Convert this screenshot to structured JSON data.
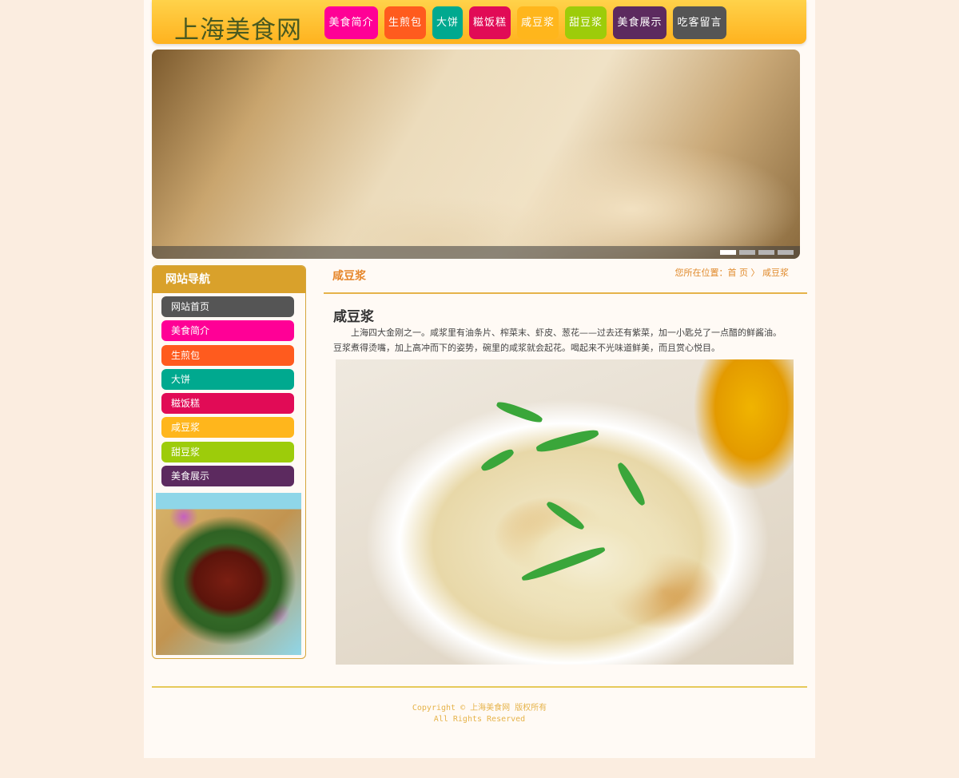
{
  "header": {
    "logo": "上海美食网",
    "nav": [
      {
        "label": "美食简介",
        "color": "#ff0096"
      },
      {
        "label": "生煎包",
        "color": "#ff5b1e"
      },
      {
        "label": "大饼",
        "color": "#00a98f"
      },
      {
        "label": "糍饭糕",
        "color": "#e10b56"
      },
      {
        "label": "咸豆浆",
        "color": "#ffb61c"
      },
      {
        "label": "甜豆浆",
        "color": "#9dcc0a"
      },
      {
        "label": "美食展示",
        "color": "#5c2a5f"
      },
      {
        "label": "吃客留言",
        "color": "#555555"
      }
    ]
  },
  "banner": {
    "image": "soup-dumplings-photo",
    "slide_count": 4,
    "active_slide": 1
  },
  "sidebar": {
    "title": "网站导航",
    "items": [
      {
        "label": "网站首页",
        "color": "#555555"
      },
      {
        "label": "美食简介",
        "color": "#ff0096"
      },
      {
        "label": "生煎包",
        "color": "#ff5b1e"
      },
      {
        "label": "大饼",
        "color": "#00a98f"
      },
      {
        "label": "糍饭糕",
        "color": "#e10b56"
      },
      {
        "label": "咸豆浆",
        "color": "#ffb61c"
      },
      {
        "label": "甜豆浆",
        "color": "#9dcc0a"
      },
      {
        "label": "美食展示",
        "color": "#5c2a5f"
      }
    ],
    "image": "braised-pork-photo"
  },
  "content": {
    "title": "咸豆浆",
    "breadcrumb": {
      "prefix": "您所在位置：",
      "home": "首 页",
      "separator": " 〉",
      "current": "咸豆浆"
    },
    "article_title": "咸豆浆",
    "article_text": "上海四大金刚之一。咸浆里有油条片、榨菜末、虾皮、葱花——过去还有紫菜，加一小匙兑了一点醋的鲜酱油。豆浆煮得烫嘴，加上高冲而下的姿势，碗里的咸浆就会起花。喝起来不光味道鲜美，而且赏心悦目。",
    "image": "salty-soy-milk-photo"
  },
  "footer": {
    "copyright": "Copyright © 上海美食网 版权所有",
    "rights": "All Rights Reserved"
  }
}
